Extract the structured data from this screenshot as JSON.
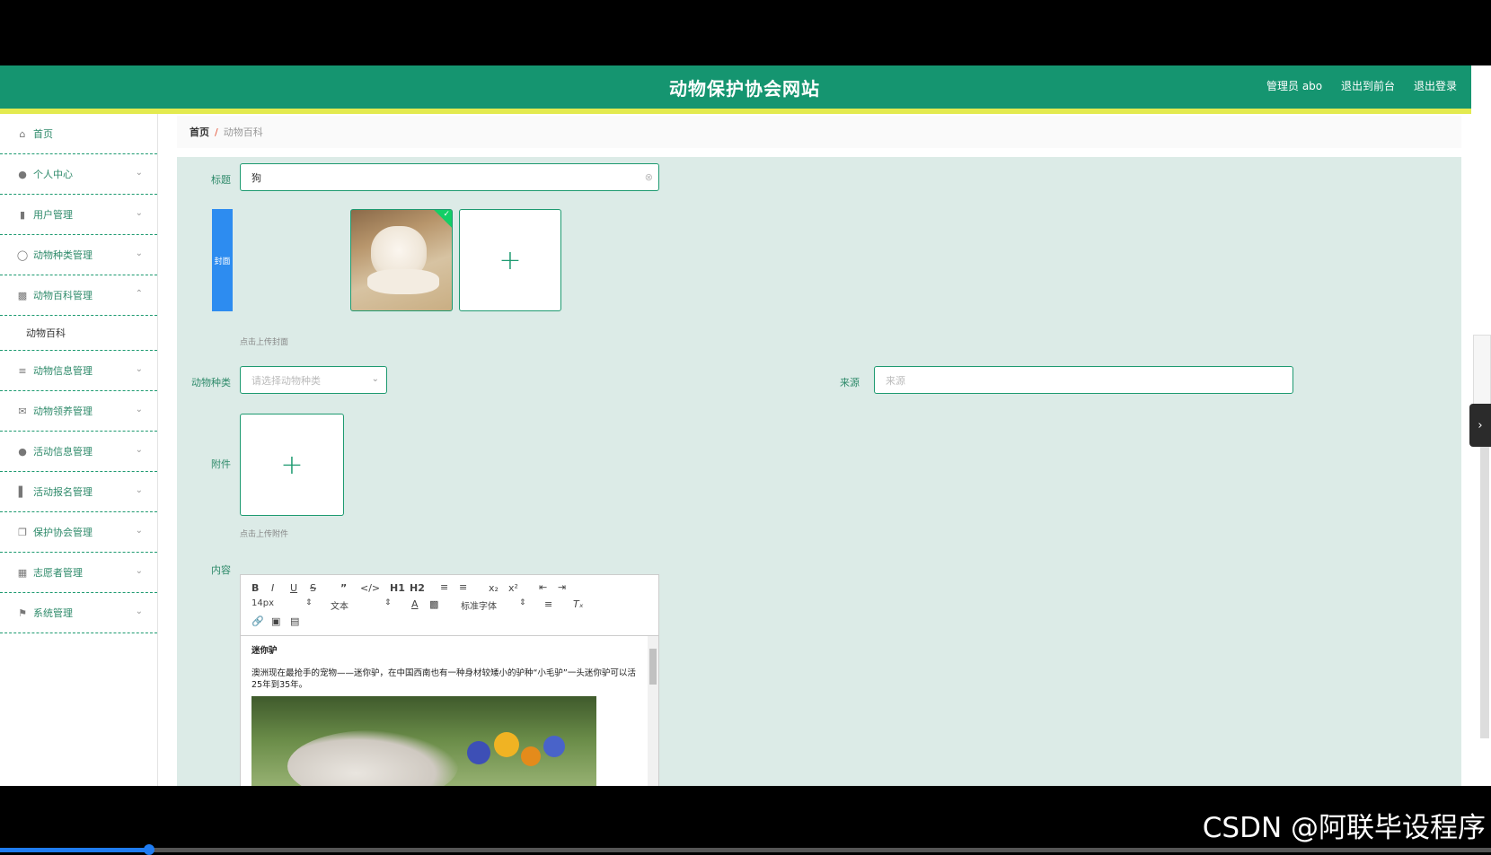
{
  "header": {
    "title": "动物保护协会网站",
    "admin_label": "管理员 abo",
    "to_front": "退出到前台",
    "logout": "退出登录"
  },
  "sidebar": {
    "items": [
      {
        "label": "首页",
        "icon": "home-icon"
      },
      {
        "label": "个人中心",
        "icon": "user-icon"
      },
      {
        "label": "用户管理",
        "icon": "users-icon"
      },
      {
        "label": "动物种类管理",
        "icon": "microphone-icon"
      },
      {
        "label": "动物百科管理",
        "icon": "clipboard-icon"
      },
      {
        "label": "动物百科",
        "icon": ""
      },
      {
        "label": "动物信息管理",
        "icon": "sliders-icon"
      },
      {
        "label": "动物领养管理",
        "icon": "mail-icon"
      },
      {
        "label": "活动信息管理",
        "icon": "person-icon"
      },
      {
        "label": "活动报名管理",
        "icon": "bar-chart-icon"
      },
      {
        "label": "保护协会管理",
        "icon": "copy-icon"
      },
      {
        "label": "志愿者管理",
        "icon": "library-icon"
      },
      {
        "label": "系统管理",
        "icon": "flag-icon"
      }
    ]
  },
  "breadcrumb": {
    "home": "首页",
    "separator": "/",
    "current": "动物百科"
  },
  "form": {
    "title_label": "标题",
    "title_value": "狗",
    "cover_label": "封面",
    "cover_hint": "点击上传封面",
    "species_label": "动物种类",
    "species_placeholder": "请选择动物种类",
    "source_label": "来源",
    "source_placeholder": "来源",
    "attachment_label": "附件",
    "attachment_hint": "点击上传附件",
    "content_label": "内容"
  },
  "editor": {
    "toolbar": {
      "font_size": "14px",
      "block": "文本",
      "font_family": "标准字体"
    },
    "heading": "迷你驴",
    "paragraph": "澳洲现在最抢手的宠物——迷你驴，在中国西南也有一种身材较矮小的驴种“小毛驴”一头迷你驴可以活25年到35年。"
  },
  "watermark": "CSDN @阿联毕设程序",
  "colors": {
    "brand": "#159570",
    "stripe": "#e3ea4f",
    "form_bg": "#dcebe7",
    "accent_blue": "#2d8cf0"
  }
}
